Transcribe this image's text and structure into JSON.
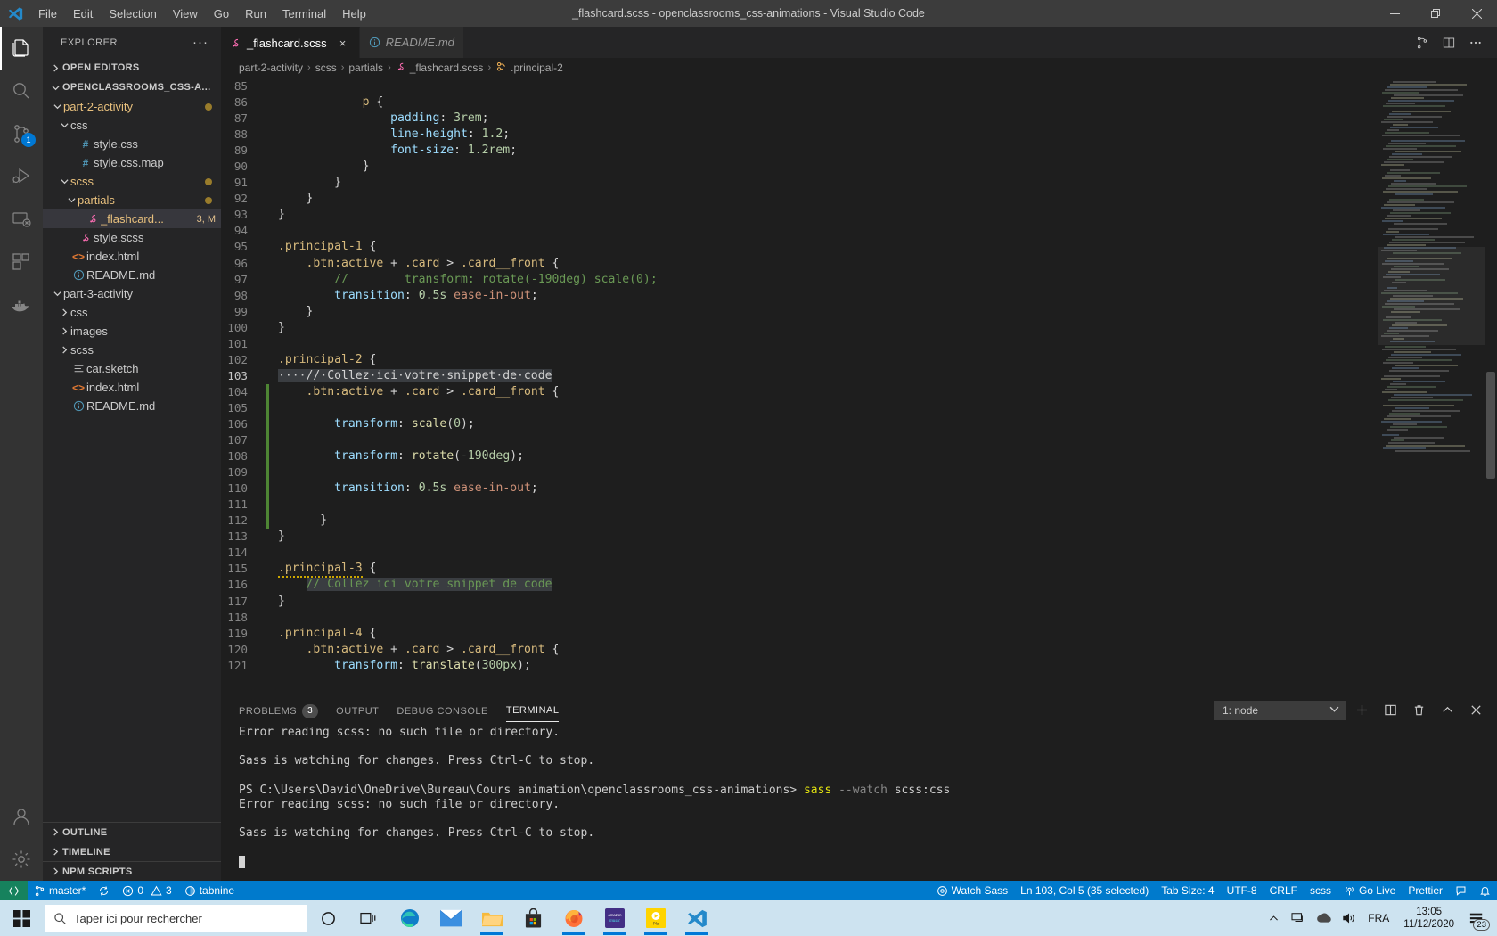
{
  "titlebar": {
    "window_title": "_flashcard.scss - openclassrooms_css-animations - Visual Studio Code",
    "menus": [
      "File",
      "Edit",
      "Selection",
      "View",
      "Go",
      "Run",
      "Terminal",
      "Help"
    ],
    "controls": {
      "minimize": "minimize-icon",
      "maximize": "restore-icon",
      "close": "close-icon"
    }
  },
  "activitybar": {
    "items": [
      {
        "name": "explorer",
        "icon": "files-icon",
        "badge": ""
      },
      {
        "name": "search",
        "icon": "search-icon",
        "badge": ""
      },
      {
        "name": "source-control",
        "icon": "source-control-icon",
        "badge": "1"
      },
      {
        "name": "run-and-debug",
        "icon": "debug-icon",
        "badge": ""
      },
      {
        "name": "remote-explorer",
        "icon": "remote-explorer-icon",
        "badge": ""
      },
      {
        "name": "extensions",
        "icon": "extensions-icon",
        "badge": ""
      },
      {
        "name": "docker",
        "icon": "docker-icon",
        "badge": ""
      }
    ],
    "bottom": [
      {
        "name": "accounts",
        "icon": "account-icon"
      },
      {
        "name": "settings",
        "icon": "gear-icon"
      }
    ]
  },
  "sidebar": {
    "title": "EXPLORER",
    "more_label": "···",
    "sections": {
      "open_editors": "OPEN EDITORS",
      "workspace": "OPENCLASSROOMS_CSS-A...",
      "outline": "OUTLINE",
      "timeline": "TIMELINE",
      "npm_scripts": "NPM SCRIPTS"
    },
    "tree": [
      {
        "label": "part-2-activity",
        "indent": 1,
        "type": "folder",
        "expanded": true,
        "dirty": true,
        "color": "#e8c07d"
      },
      {
        "label": "css",
        "indent": 2,
        "type": "folder",
        "expanded": true,
        "dirty": false,
        "color": "#cccccc"
      },
      {
        "label": "style.css",
        "indent": 3,
        "type": "file",
        "icon": "#",
        "iconColor": "#519aba",
        "dirty": false
      },
      {
        "label": "style.css.map",
        "indent": 3,
        "type": "file",
        "icon": "#",
        "iconColor": "#519aba",
        "dirty": false
      },
      {
        "label": "scss",
        "indent": 2,
        "type": "folder",
        "expanded": true,
        "dirty": true,
        "color": "#e8c07d"
      },
      {
        "label": "partials",
        "indent": 3,
        "type": "folder",
        "expanded": true,
        "dirty": true,
        "color": "#e8c07d"
      },
      {
        "label": "_flashcard...",
        "indent": 4,
        "type": "file",
        "icon": "sass-icon",
        "iconColor": "#ff69b4",
        "selected": true,
        "deco": "3, M"
      },
      {
        "label": "style.scss",
        "indent": 3,
        "type": "file",
        "icon": "sass-icon",
        "iconColor": "#ff69b4",
        "dirty": false
      },
      {
        "label": "index.html",
        "indent": 2,
        "type": "file",
        "icon": "<>",
        "iconColor": "#e37933",
        "dirty": false
      },
      {
        "label": "README.md",
        "indent": 2,
        "type": "file",
        "icon": "info-icon",
        "iconColor": "#519aba",
        "dirty": false
      },
      {
        "label": "part-3-activity",
        "indent": 1,
        "type": "folder",
        "expanded": true,
        "dirty": false,
        "color": "#cccccc"
      },
      {
        "label": "css",
        "indent": 2,
        "type": "folder",
        "expanded": false,
        "dirty": false,
        "color": "#cccccc"
      },
      {
        "label": "images",
        "indent": 2,
        "type": "folder",
        "expanded": false,
        "dirty": false,
        "color": "#cccccc"
      },
      {
        "label": "scss",
        "indent": 2,
        "type": "folder",
        "expanded": false,
        "dirty": false,
        "color": "#cccccc"
      },
      {
        "label": "car.sketch",
        "indent": 2,
        "type": "file",
        "icon": "lines-icon",
        "iconColor": "#cccccc",
        "dirty": false
      },
      {
        "label": "index.html",
        "indent": 2,
        "type": "file",
        "icon": "<>",
        "iconColor": "#e37933",
        "dirty": false
      },
      {
        "label": "README.md",
        "indent": 2,
        "type": "file",
        "icon": "info-icon",
        "iconColor": "#519aba",
        "dirty": false
      }
    ]
  },
  "tabs": [
    {
      "label": "_flashcard.scss",
      "icon": "sass-icon",
      "active": true,
      "close": "×"
    },
    {
      "label": "README.md",
      "icon": "info-icon",
      "active": false,
      "close": ""
    }
  ],
  "tab_actions": [
    "split-editor-icon",
    "split-editor-vertical-icon",
    "more-actions-icon"
  ],
  "breadcrumbs": [
    {
      "label": "part-2-activity",
      "icon": ""
    },
    {
      "label": "scss",
      "icon": ""
    },
    {
      "label": "partials",
      "icon": ""
    },
    {
      "label": "_flashcard.scss",
      "icon": "sass-icon"
    },
    {
      "label": ".principal-2",
      "icon": "css-rule-icon"
    }
  ],
  "editor": {
    "first_line": 85,
    "lines": [
      {
        "n": 85,
        "text": ""
      },
      {
        "n": 86,
        "text": "            p {"
      },
      {
        "n": 87,
        "text": "                padding: 3rem;"
      },
      {
        "n": 88,
        "text": "                line-height: 1.2;"
      },
      {
        "n": 89,
        "text": "                font-size: 1.2rem;"
      },
      {
        "n": 90,
        "text": "            }"
      },
      {
        "n": 91,
        "text": "        }"
      },
      {
        "n": 92,
        "text": "    }"
      },
      {
        "n": 93,
        "text": "}"
      },
      {
        "n": 94,
        "text": ""
      },
      {
        "n": 95,
        "text": ".principal-1 {"
      },
      {
        "n": 96,
        "text": "    .btn:active + .card > .card__front {"
      },
      {
        "n": 97,
        "text": "        //        transform: rotate(-190deg) scale(0);"
      },
      {
        "n": 98,
        "text": "        transition: 0.5s ease-in-out;"
      },
      {
        "n": 99,
        "text": "    }"
      },
      {
        "n": 100,
        "text": "}"
      },
      {
        "n": 101,
        "text": ""
      },
      {
        "n": 102,
        "text": ".principal-2 {"
      },
      {
        "n": 103,
        "text": "    // Collez ici votre snippet de code"
      },
      {
        "n": 104,
        "text": "    .btn:active + .card > .card__front {"
      },
      {
        "n": 105,
        "text": ""
      },
      {
        "n": 106,
        "text": "        transform: scale(0);"
      },
      {
        "n": 107,
        "text": ""
      },
      {
        "n": 108,
        "text": "        transform: rotate(-190deg);"
      },
      {
        "n": 109,
        "text": ""
      },
      {
        "n": 110,
        "text": "        transition: 0.5s ease-in-out;"
      },
      {
        "n": 111,
        "text": ""
      },
      {
        "n": 112,
        "text": "      }"
      },
      {
        "n": 113,
        "text": "}"
      },
      {
        "n": 114,
        "text": ""
      },
      {
        "n": 115,
        "text": ".principal-3 {"
      },
      {
        "n": 116,
        "text": "    // Collez ici votre snippet de code"
      },
      {
        "n": 117,
        "text": "}"
      },
      {
        "n": 118,
        "text": ""
      },
      {
        "n": 119,
        "text": ".principal-4 {"
      },
      {
        "n": 120,
        "text": "    .btn:active + .card > .card__front {"
      },
      {
        "n": 121,
        "text": "        transform: translate(300px);"
      }
    ]
  },
  "panel": {
    "tabs": [
      {
        "label": "PROBLEMS",
        "badge": "3",
        "active": false
      },
      {
        "label": "OUTPUT",
        "badge": "",
        "active": false
      },
      {
        "label": "DEBUG CONSOLE",
        "badge": "",
        "active": false
      },
      {
        "label": "TERMINAL",
        "badge": "",
        "active": true
      }
    ],
    "terminal_select": "1: node",
    "actions": [
      "new-terminal-icon",
      "split-terminal-icon",
      "kill-terminal-icon",
      "maximize-panel-icon",
      "close-panel-icon"
    ],
    "terminal_lines": [
      {
        "text": "Error reading scss: no such file or directory.",
        "style": "normal"
      },
      {
        "text": "",
        "style": "normal"
      },
      {
        "text": "Sass is watching for changes. Press Ctrl-C to stop.",
        "style": "normal"
      },
      {
        "text": "",
        "style": "normal"
      },
      {
        "text": "",
        "style": "prompt"
      },
      {
        "text": "Error reading scss: no such file or directory.",
        "style": "normal"
      },
      {
        "text": "",
        "style": "normal"
      },
      {
        "text": "Sass is watching for changes. Press Ctrl-C to stop.",
        "style": "normal"
      },
      {
        "text": "",
        "style": "normal"
      },
      {
        "text": "",
        "style": "cursor"
      }
    ],
    "prompt": {
      "path": "PS C:\\Users\\David\\OneDrive\\Bureau\\Cours animation\\openclassrooms_css-animations> ",
      "cmd": "sass",
      "flag": " --watch ",
      "args": "scss:css"
    }
  },
  "statusbar": {
    "left": [
      {
        "name": "remote-indicator",
        "label": "",
        "icon": "remote-icon"
      },
      {
        "name": "branch",
        "label": "master*",
        "icon": "git-branch-icon"
      },
      {
        "name": "sync",
        "label": "",
        "icon": "sync-icon"
      },
      {
        "name": "problems",
        "label": "0  3",
        "icon": "error-warning-icon"
      },
      {
        "name": "tabnine",
        "label": "tabnine",
        "icon": "tabnine-icon"
      }
    ],
    "right": [
      {
        "name": "watch-sass",
        "label": "Watch Sass",
        "icon": "eye-icon"
      },
      {
        "name": "cursor-position",
        "label": "Ln 103, Col 5 (35 selected)",
        "icon": ""
      },
      {
        "name": "indentation",
        "label": "Tab Size: 4",
        "icon": ""
      },
      {
        "name": "encoding",
        "label": "UTF-8",
        "icon": ""
      },
      {
        "name": "eol",
        "label": "CRLF",
        "icon": ""
      },
      {
        "name": "language-mode",
        "label": "scss",
        "icon": ""
      },
      {
        "name": "go-live",
        "label": "Go Live",
        "icon": "broadcast-icon"
      },
      {
        "name": "prettier",
        "label": "Prettier",
        "icon": ""
      },
      {
        "name": "feedback",
        "label": "",
        "icon": "feedback-icon"
      },
      {
        "name": "notifications",
        "label": "",
        "icon": "bell-icon"
      }
    ]
  },
  "taskbar": {
    "start": "windows-start-icon",
    "search_placeholder": "Taper ici pour rechercher",
    "cortana": "cortana-icon",
    "task_view": "task-view-icon",
    "apps": [
      {
        "name": "microsoft-edge",
        "running": false
      },
      {
        "name": "mail",
        "running": false
      },
      {
        "name": "file-explorer",
        "running": true
      },
      {
        "name": "microsoft-store",
        "running": false
      },
      {
        "name": "firefox",
        "running": true
      },
      {
        "name": "amazon-music",
        "running": true
      },
      {
        "name": "app-yellow",
        "running": true
      },
      {
        "name": "visual-studio-code",
        "running": true
      }
    ],
    "tray": [
      "show-hidden-icons",
      "network-icon",
      "onedrive-icon",
      "volume-icon"
    ],
    "language": "FRA",
    "time": "13:05",
    "date": "11/12/2020",
    "notification_count": "23"
  }
}
